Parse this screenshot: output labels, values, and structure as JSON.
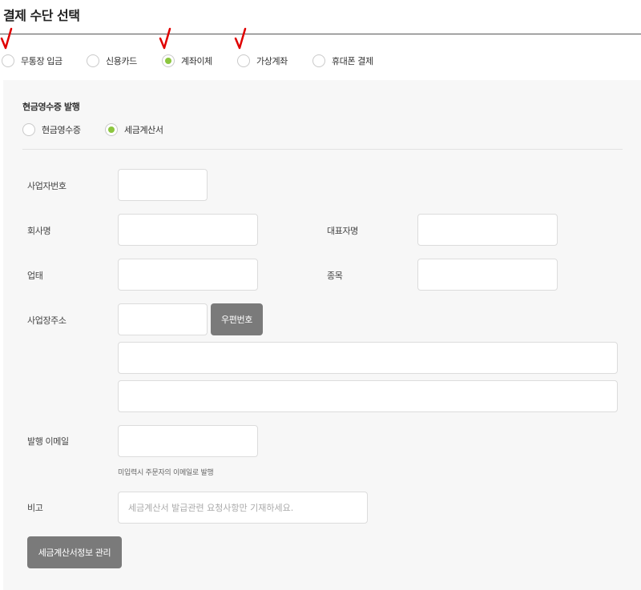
{
  "page": {
    "title": "결제 수단 선택"
  },
  "colors": {
    "radio_checked": "#8cc63f",
    "check_mark": "#e00000",
    "button_bg": "#7a7a7a",
    "panel_bg": "#f7f7f7"
  },
  "payment_methods": [
    {
      "label": "무통장 입금",
      "checked": false,
      "marked": true
    },
    {
      "label": "신용카드",
      "checked": false,
      "marked": false
    },
    {
      "label": "계좌이체",
      "checked": true,
      "marked": true
    },
    {
      "label": "가상계좌",
      "checked": false,
      "marked": true
    },
    {
      "label": "휴대폰 결제",
      "checked": false,
      "marked": false
    }
  ],
  "receipt": {
    "title": "현금영수증 발행",
    "options": [
      {
        "label": "현금영수증",
        "checked": false
      },
      {
        "label": "세금계산서",
        "checked": true
      }
    ]
  },
  "form": {
    "business_number_label": "사업자번호",
    "company_name_label": "회사명",
    "ceo_name_label": "대표자명",
    "business_type_label": "업태",
    "business_item_label": "종목",
    "address_label": "사업장주소",
    "postcode_button": "우편번호",
    "email_label": "발행 이메일",
    "email_hint": "미입력시 주문자의 이메일로 발행",
    "memo_label": "비고",
    "memo_placeholder": "세금계산서 발급관련 요청사항만 기재하세요.",
    "manage_button": "세금계산서정보 관리"
  }
}
